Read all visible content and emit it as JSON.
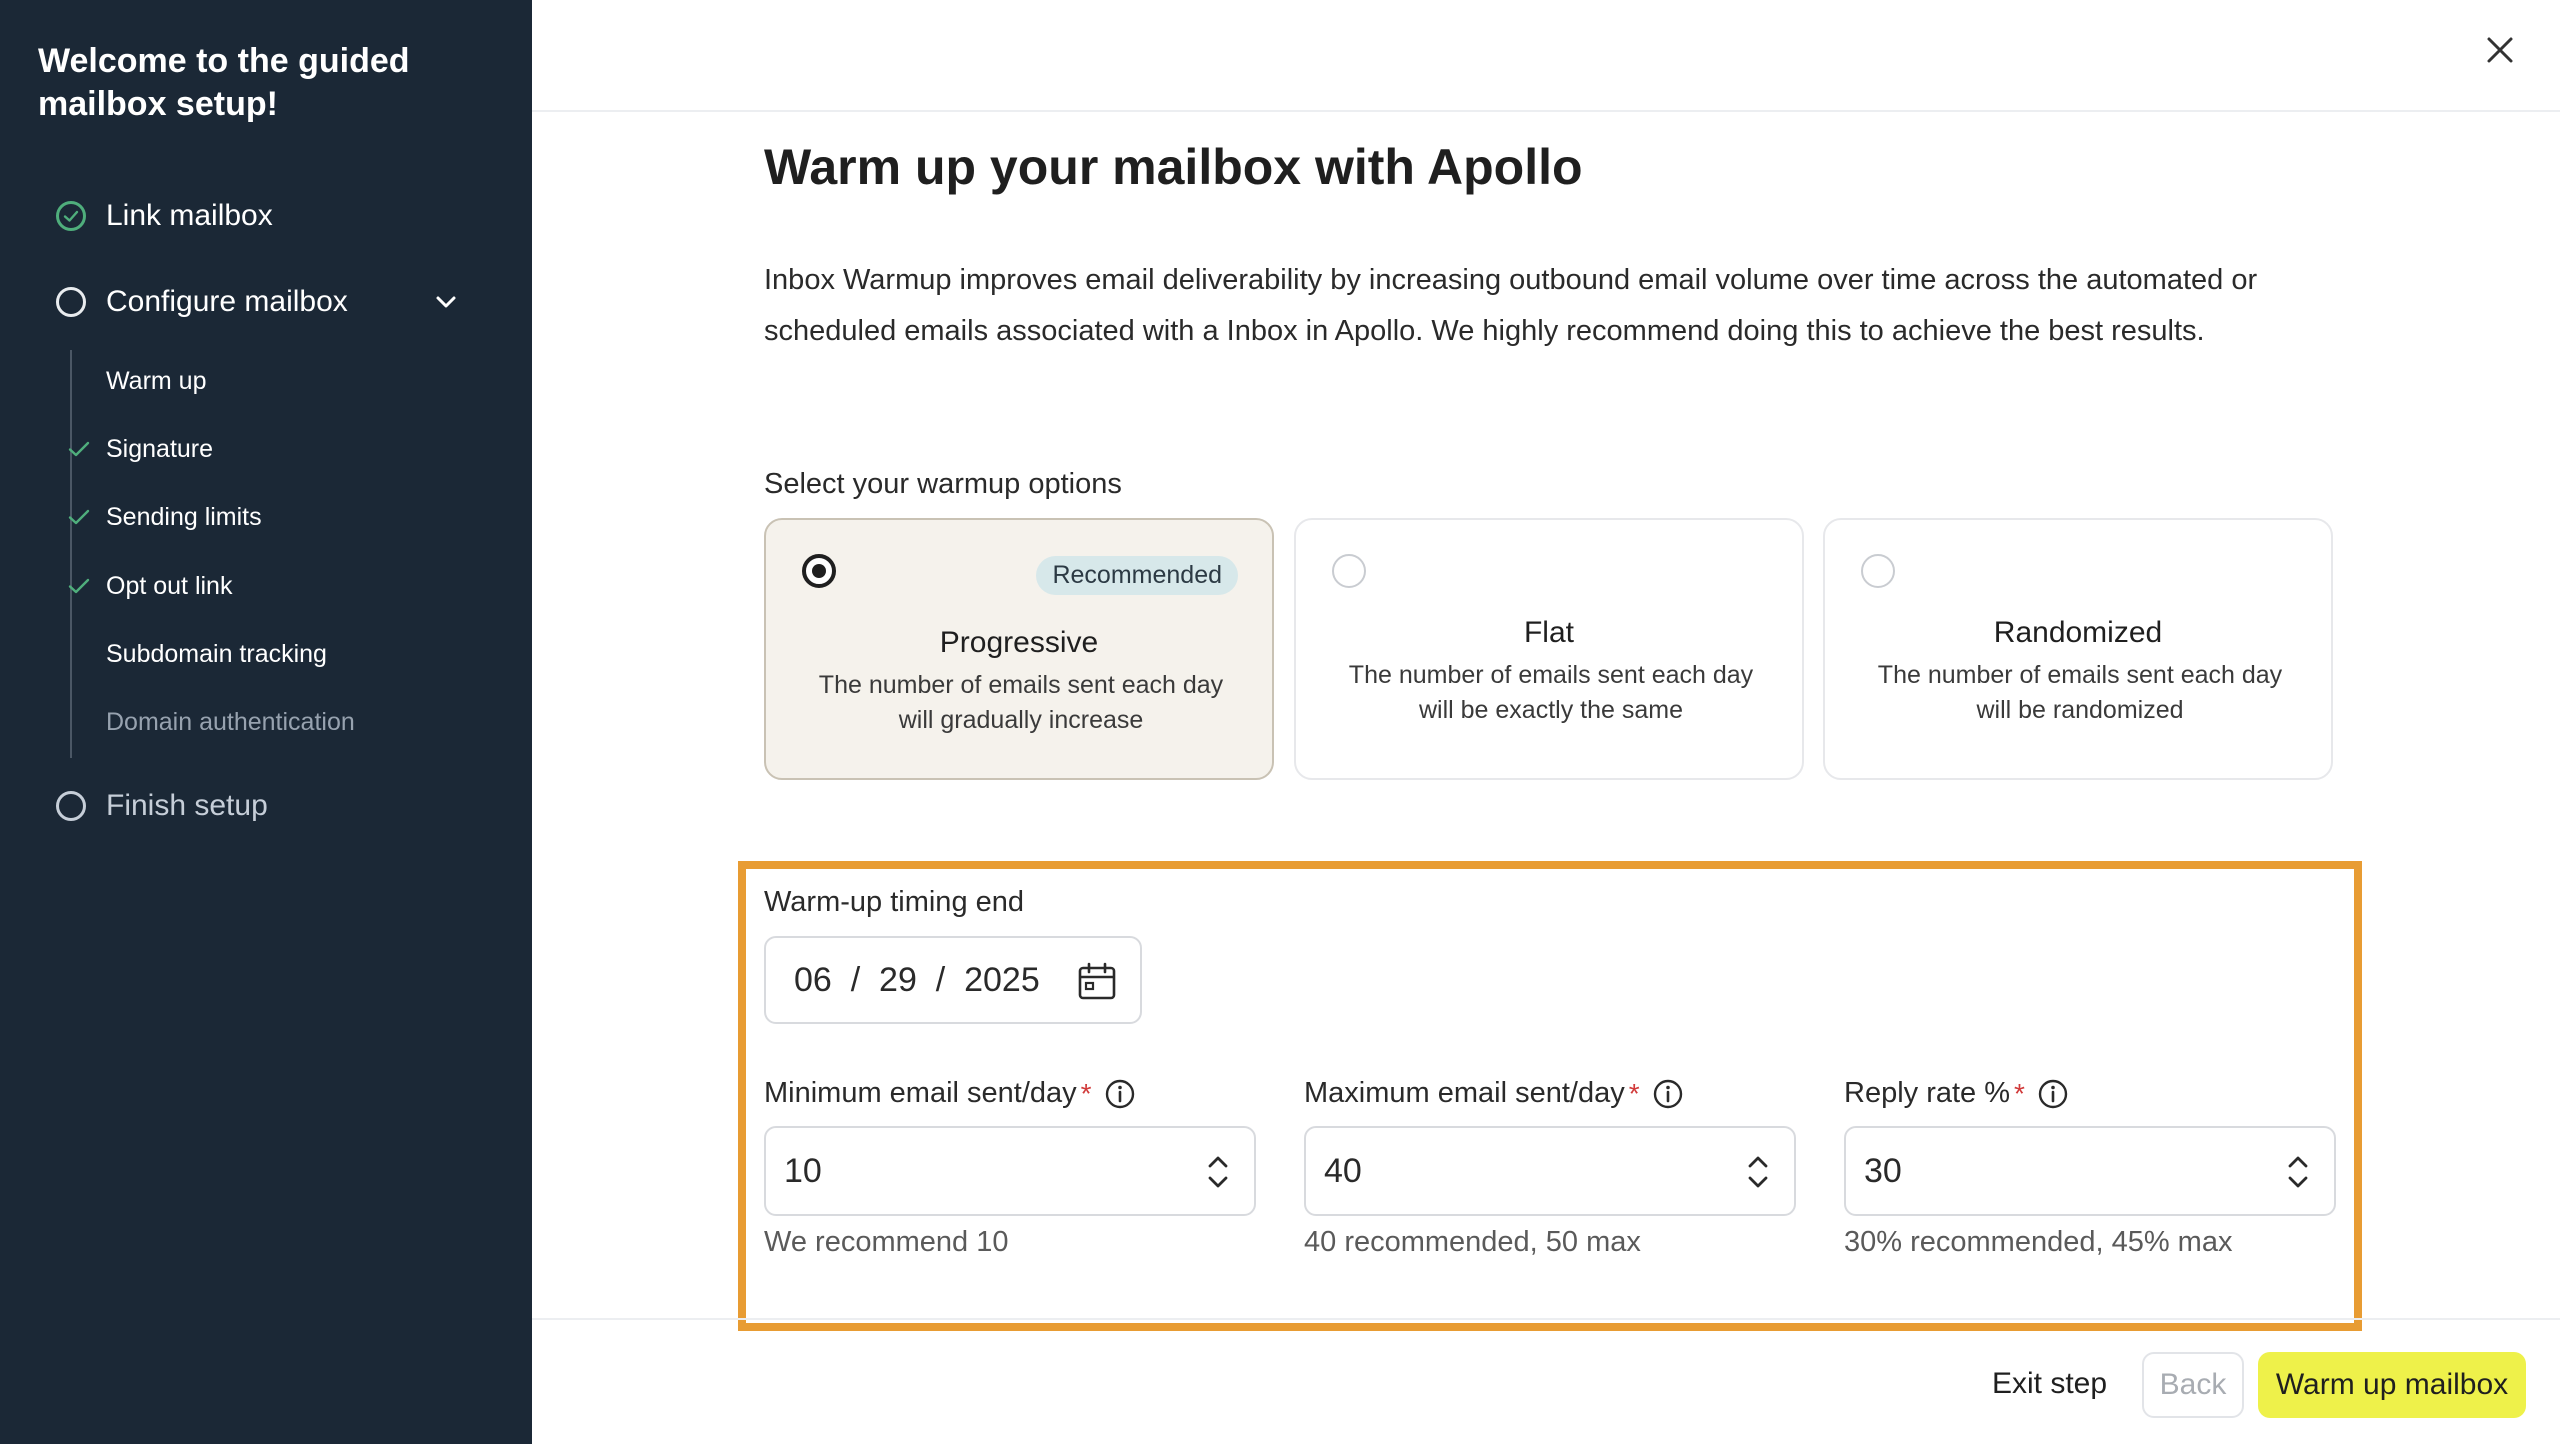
{
  "sidebar": {
    "title": "Welcome to the guided mailbox setup!",
    "steps": [
      {
        "label": "Link mailbox",
        "status": "done"
      },
      {
        "label": "Configure mailbox",
        "status": "active"
      },
      {
        "label": "Finish setup",
        "status": "pending"
      }
    ],
    "substeps": [
      {
        "label": "Warm up",
        "done": false
      },
      {
        "label": "Signature",
        "done": true
      },
      {
        "label": "Sending limits",
        "done": true
      },
      {
        "label": "Opt out link",
        "done": true
      },
      {
        "label": "Subdomain tracking",
        "done": false
      },
      {
        "label": "Domain authentication",
        "done": false
      }
    ]
  },
  "main": {
    "title": "Warm up your mailbox with Apollo",
    "description": "Inbox Warmup improves email deliverability by increasing outbound email volume over time across the automated or scheduled emails associated with a Inbox in Apollo. We highly recommend doing this to achieve the best results.",
    "options_label": "Select your warmup options",
    "options": [
      {
        "title": "Progressive",
        "description": "The number of emails sent each day will gradually increase",
        "badge": "Recommended",
        "selected": true
      },
      {
        "title": "Flat",
        "description": "The number of emails sent each day will be exactly the same",
        "selected": false
      },
      {
        "title": "Randomized",
        "description": "The number of emails sent each day will be randomized",
        "selected": false
      }
    ],
    "timing": {
      "label": "Warm-up timing end",
      "date_display": "06  /  29  /  2025"
    },
    "fields": [
      {
        "label": "Minimum email sent/day",
        "required": "*",
        "value": "10",
        "hint": "We recommend 10"
      },
      {
        "label": "Maximum email sent/day",
        "required": "*",
        "value": "40",
        "hint": "40 recommended, 50 max"
      },
      {
        "label": "Reply rate %",
        "required": "*",
        "value": "30",
        "hint": "30% recommended, 45% max"
      }
    ]
  },
  "footer": {
    "exit_label": "Exit step",
    "back_label": "Back",
    "primary_label": "Warm up mailbox"
  },
  "colors": {
    "sidebar_bg": "#1b2836",
    "accent_yellow": "#eef14a",
    "highlight_border": "#e89c33",
    "check_green": "#4fae7c"
  }
}
